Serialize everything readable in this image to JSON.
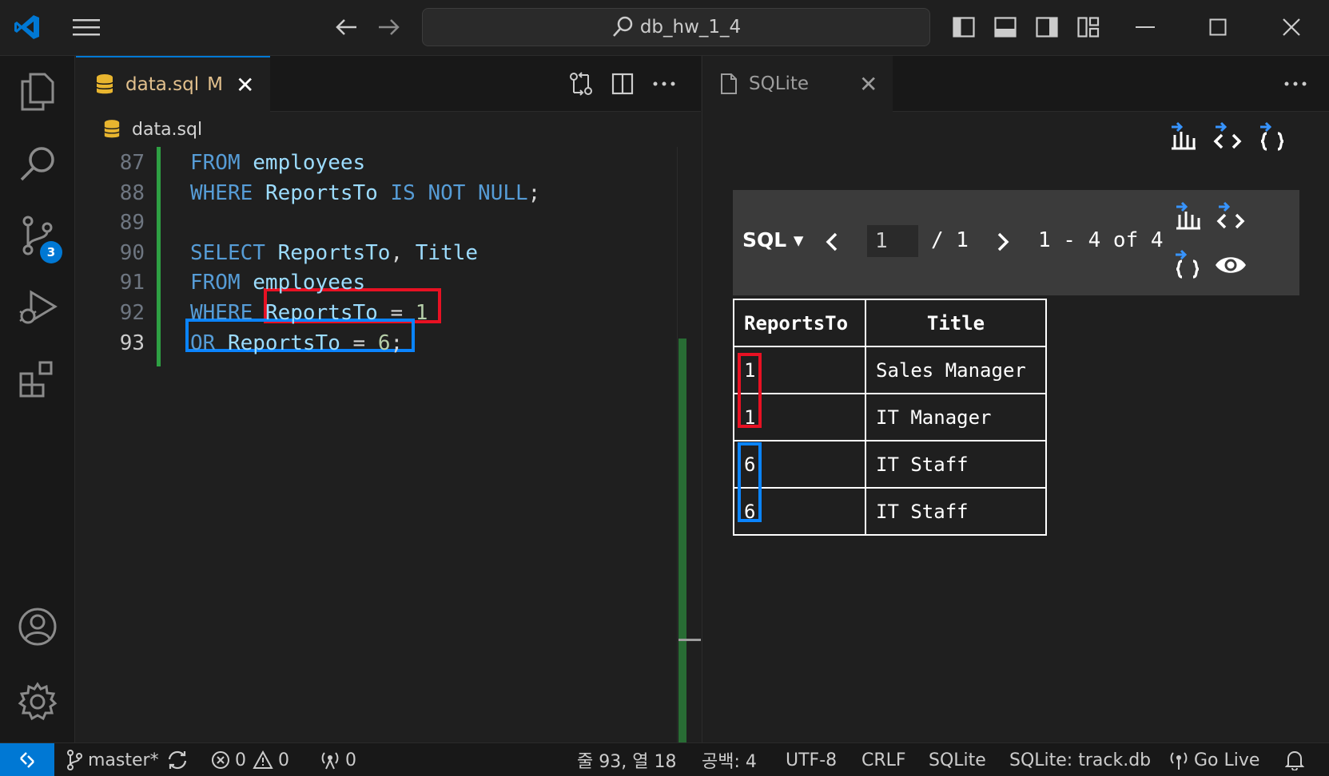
{
  "window": {
    "search_text": "db_hw_1_4"
  },
  "activity": {
    "scm_badge": "3"
  },
  "editor": {
    "tab": {
      "name": "data.sql",
      "modified": "M"
    },
    "breadcrumb": "data.sql",
    "lines": [
      {
        "num": "87",
        "tokens": [
          {
            "t": "FROM",
            "c": "kw"
          },
          {
            "t": " ",
            "c": "txt"
          },
          {
            "t": "employees",
            "c": "id"
          }
        ]
      },
      {
        "num": "88",
        "tokens": [
          {
            "t": "WHERE",
            "c": "kw"
          },
          {
            "t": " ",
            "c": "txt"
          },
          {
            "t": "ReportsTo",
            "c": "id"
          },
          {
            "t": " ",
            "c": "txt"
          },
          {
            "t": "IS NOT NULL",
            "c": "kw"
          },
          {
            "t": ";",
            "c": "txt"
          }
        ]
      },
      {
        "num": "89",
        "tokens": []
      },
      {
        "num": "90",
        "tokens": [
          {
            "t": "SELECT",
            "c": "kw"
          },
          {
            "t": " ",
            "c": "txt"
          },
          {
            "t": "ReportsTo",
            "c": "id"
          },
          {
            "t": ", ",
            "c": "txt"
          },
          {
            "t": "Title",
            "c": "id"
          }
        ]
      },
      {
        "num": "91",
        "tokens": [
          {
            "t": "FROM",
            "c": "kw"
          },
          {
            "t": " ",
            "c": "txt"
          },
          {
            "t": "employees",
            "c": "id"
          }
        ]
      },
      {
        "num": "92",
        "tokens": [
          {
            "t": "WHERE",
            "c": "kw"
          },
          {
            "t": " ",
            "c": "txt"
          },
          {
            "t": "ReportsTo",
            "c": "id"
          },
          {
            "t": " = ",
            "c": "txt"
          },
          {
            "t": "1",
            "c": "num"
          }
        ]
      },
      {
        "num": "93",
        "tokens": [
          {
            "t": "OR",
            "c": "kw"
          },
          {
            "t": " ",
            "c": "txt"
          },
          {
            "t": "ReportsTo",
            "c": "id"
          },
          {
            "t": " = ",
            "c": "txt"
          },
          {
            "t": "6",
            "c": "num"
          },
          {
            "t": ";",
            "c": "txt"
          }
        ]
      }
    ],
    "current_line": "93"
  },
  "panel": {
    "tab_label": "SQLite",
    "pager": {
      "mode": "SQL ▾",
      "page": "1",
      "of_pages": "/ 1",
      "range": "1 - 4 of 4"
    },
    "table": {
      "headers": [
        "ReportsTo",
        "Title"
      ],
      "rows": [
        [
          "1",
          "Sales Manager"
        ],
        [
          "1",
          "IT Manager"
        ],
        [
          "6",
          "IT Staff"
        ],
        [
          "6",
          "IT Staff"
        ]
      ]
    }
  },
  "status": {
    "branch": "master*",
    "errors": "0",
    "warnings": "0",
    "ports": "0",
    "position": "줄 93, 열 18",
    "indent": "공백: 4",
    "encoding": "UTF-8",
    "eol": "CRLF",
    "language": "SQLite",
    "db": "SQLite: track.db",
    "golive": "Go Live"
  },
  "colors": {
    "accent": "#0078d4",
    "highlight_red": "#e81123",
    "highlight_blue": "#0a84ff",
    "git_added": "#2ea043"
  },
  "icons": [
    "vscode-logo-icon",
    "menu-icon",
    "back-icon",
    "forward-icon",
    "search-icon",
    "toggle-sidebar-icon",
    "toggle-panel-icon",
    "toggle-secondary-sidebar-icon",
    "customize-layout-icon",
    "minimize-icon",
    "maximize-icon",
    "close-window-icon",
    "explorer-icon",
    "search-view-icon",
    "source-control-icon",
    "run-debug-icon",
    "extensions-icon",
    "account-icon",
    "settings-gear-icon",
    "database-file-icon",
    "compare-changes-icon",
    "split-editor-icon",
    "more-actions-icon",
    "file-icon",
    "export-csv-icon",
    "export-sql-icon",
    "export-json-icon",
    "eye-icon",
    "prev-page-icon",
    "next-page-icon",
    "remote-icon",
    "branch-icon",
    "sync-icon",
    "error-icon",
    "warning-icon",
    "ports-icon",
    "broadcast-icon",
    "bell-icon"
  ]
}
